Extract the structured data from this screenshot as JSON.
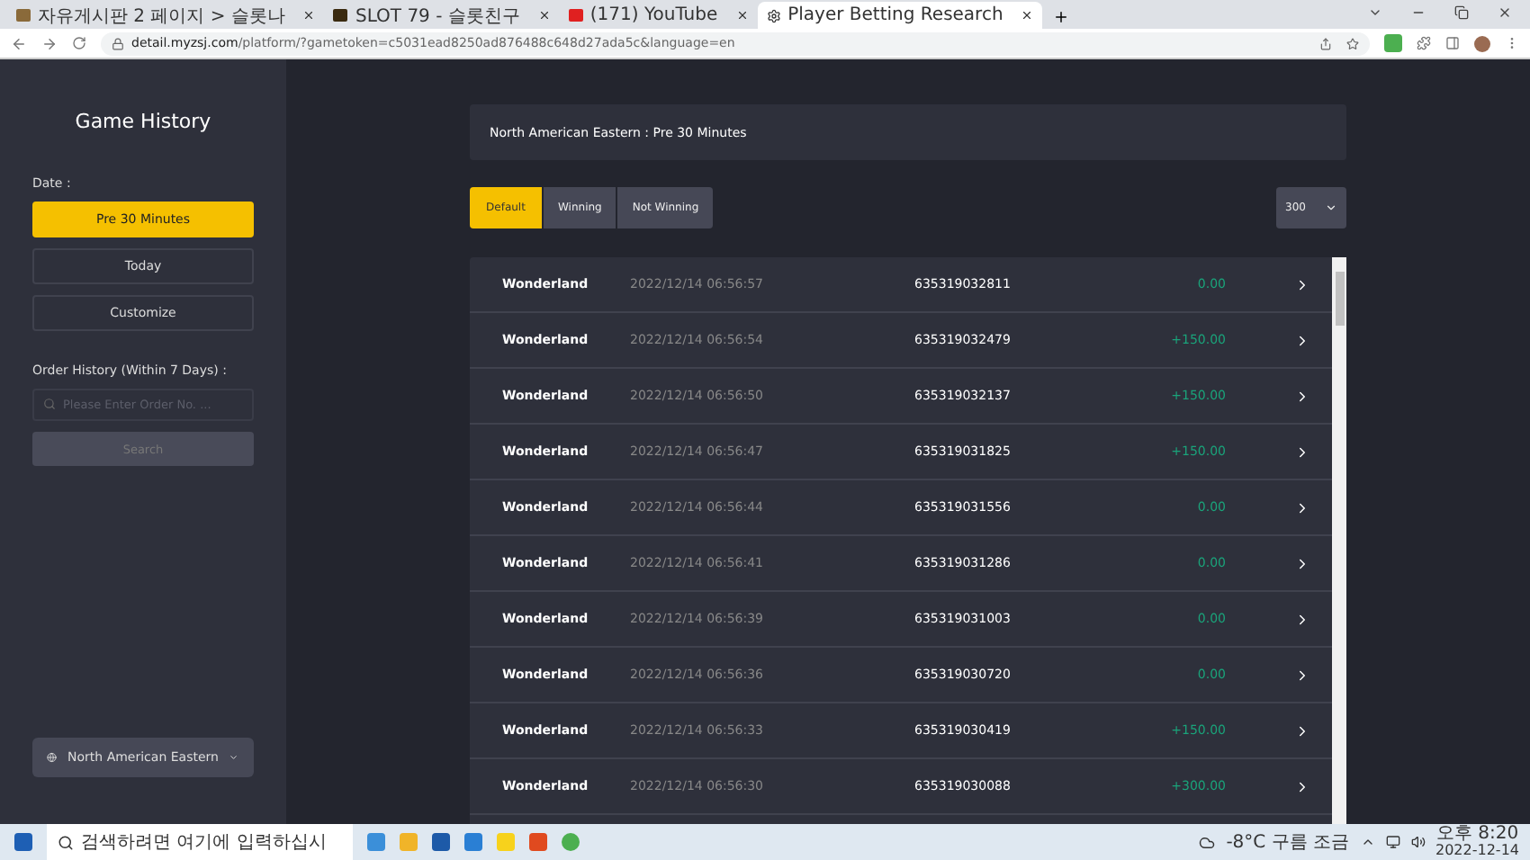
{
  "browser": {
    "tabs": [
      {
        "title": "자유게시판 2 페이지 > 슬롯나",
        "selected": false,
        "kind": "forum"
      },
      {
        "title": "SLOT 79 - 슬롯친구",
        "selected": false,
        "kind": "slot"
      },
      {
        "title": "(171) YouTube",
        "selected": false,
        "kind": "video"
      },
      {
        "title": "Player Betting Research",
        "selected": true,
        "kind": "gear"
      }
    ],
    "url_host": "detail.myzsj.com",
    "url_path": "/platform/?gametoken=c5031ead8250ad876488c648d27ada5c&language=en"
  },
  "sidebar": {
    "title": "Game History",
    "date_label": "Date :",
    "date_options": [
      {
        "label": "Pre 30 Minutes",
        "selected": true
      },
      {
        "label": "Today",
        "selected": false
      },
      {
        "label": "Customize",
        "selected": false
      }
    ],
    "order_label": "Order History (Within 7 Days) :",
    "order_placeholder": "Please Enter Order No. ...",
    "search_button": "Search",
    "region": "North American Eastern"
  },
  "header": "North American Eastern : Pre 30 Minutes",
  "filters": [
    {
      "label": "Default",
      "selected": true
    },
    {
      "label": "Winning",
      "selected": false
    },
    {
      "label": "Not Winning",
      "selected": false
    }
  ],
  "page_size": "300",
  "rows": [
    {
      "game": "Wonderland",
      "time": "2022/12/14 06:56:57",
      "order": "635319032811",
      "amount": "0.00"
    },
    {
      "game": "Wonderland",
      "time": "2022/12/14 06:56:54",
      "order": "635319032479",
      "amount": "+150.00"
    },
    {
      "game": "Wonderland",
      "time": "2022/12/14 06:56:50",
      "order": "635319032137",
      "amount": "+150.00"
    },
    {
      "game": "Wonderland",
      "time": "2022/12/14 06:56:47",
      "order": "635319031825",
      "amount": "+150.00"
    },
    {
      "game": "Wonderland",
      "time": "2022/12/14 06:56:44",
      "order": "635319031556",
      "amount": "0.00"
    },
    {
      "game": "Wonderland",
      "time": "2022/12/14 06:56:41",
      "order": "635319031286",
      "amount": "0.00"
    },
    {
      "game": "Wonderland",
      "time": "2022/12/14 06:56:39",
      "order": "635319031003",
      "amount": "0.00"
    },
    {
      "game": "Wonderland",
      "time": "2022/12/14 06:56:36",
      "order": "635319030720",
      "amount": "0.00"
    },
    {
      "game": "Wonderland",
      "time": "2022/12/14 06:56:33",
      "order": "635319030419",
      "amount": "+150.00"
    },
    {
      "game": "Wonderland",
      "time": "2022/12/14 06:56:30",
      "order": "635319030088",
      "amount": "+300.00"
    }
  ],
  "taskbar": {
    "search_placeholder": "검색하려면 여기에 입력하십시",
    "weather": "-8°C 구름 조금",
    "time": "오후 8:20",
    "date": "2022-12-14"
  }
}
